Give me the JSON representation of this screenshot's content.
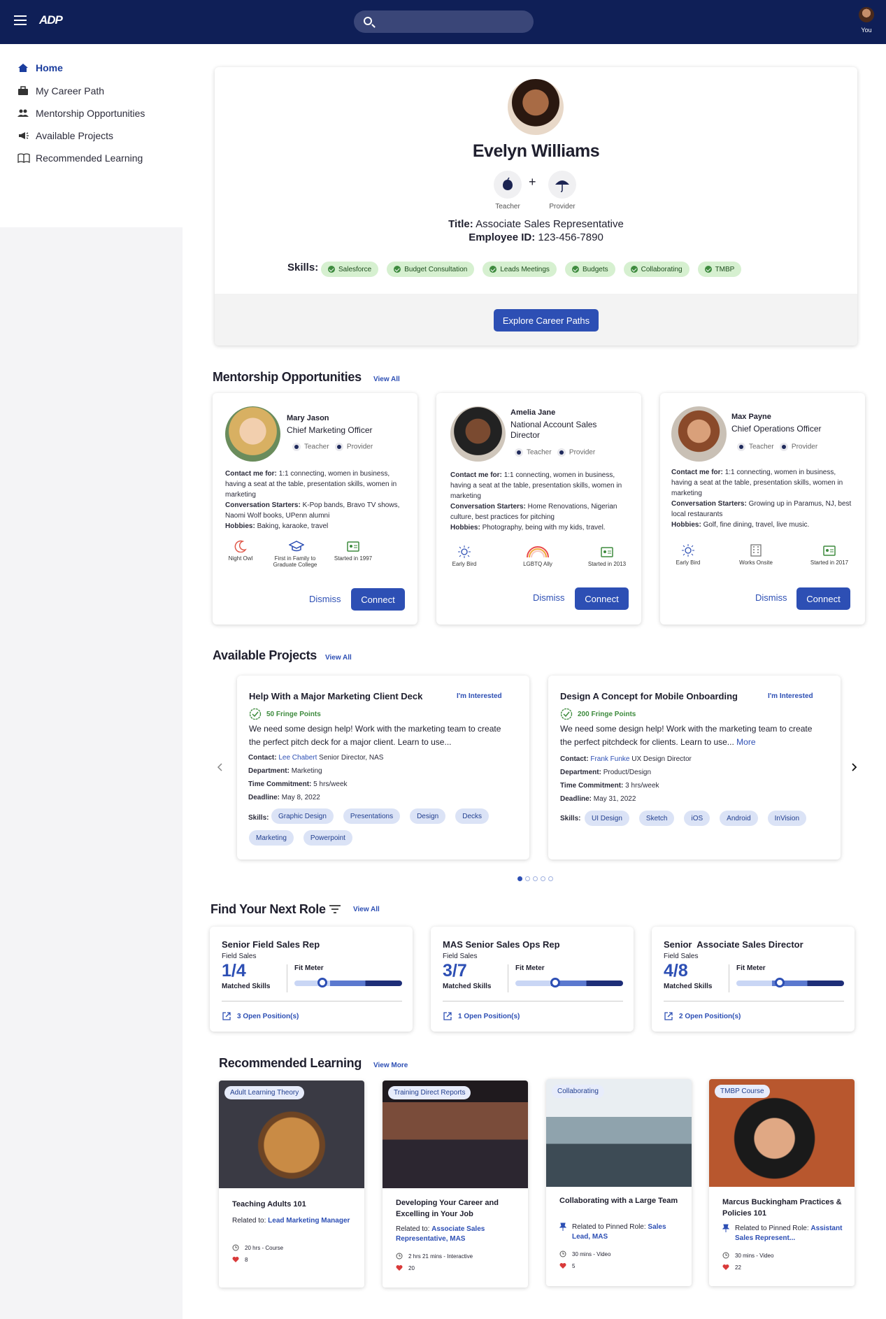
{
  "header": {
    "user_label": "You"
  },
  "sidebar": {
    "items": [
      {
        "label": "Home",
        "icon": "home-icon"
      },
      {
        "label": "My Career Path",
        "icon": "briefcase-icon"
      },
      {
        "label": "Mentorship Opportunities",
        "icon": "people-icon"
      },
      {
        "label": "Available Projects",
        "icon": "megaphone-icon"
      },
      {
        "label": "Recommended Learning",
        "icon": "book-icon"
      }
    ]
  },
  "profile": {
    "name": "Evelyn Williams",
    "roles": [
      "Teacher",
      "Provider"
    ],
    "plus": "+",
    "title_label": "Title:",
    "title": "Associate Sales Representative",
    "employee_label": "Employee ID:",
    "employee_id": "123-456-7890",
    "skills_label": "Skills:",
    "skills": [
      "Salesforce",
      "Budget Consultation",
      "Leads Meetings",
      "Budgets",
      "Collaborating",
      "TMBP"
    ],
    "explore_button": "Explore Career Paths"
  },
  "mentorship": {
    "heading": "Mentorship Opportunities",
    "view_all": "View All",
    "role_teacher": "Teacher",
    "role_provider": "Provider",
    "contact_label": "Contact me for:",
    "starters_label": "Conversation Starters:",
    "hobbies_label": "Hobbies:",
    "dismiss": "Dismiss",
    "connect": "Connect",
    "mentors": [
      {
        "name": "Mary Jason",
        "title": "Chief Marketing Officer",
        "contact": "1:1 connecting, women in business, having a seat at the table, presentation skills, women in marketing",
        "starters": "K-Pop bands, Bravo TV shows, Naomi Wolf books, UPenn alumni",
        "hobbies": "Baking, karaoke, travel",
        "badges": [
          "Night Owl",
          "First in Family to Graduate College",
          "Started in 1997"
        ]
      },
      {
        "name": "Amelia Jane",
        "title": "National Account Sales Director",
        "contact": "1:1 connecting, women in business, having a seat at the table, presentation skills, women in marketing",
        "starters": "Home Renovations, Nigerian culture, best practices for pitching",
        "hobbies": "Photography, being with my kids, travel.",
        "badges": [
          "Early Bird",
          "LGBTQ Ally",
          "Started in 2013"
        ]
      },
      {
        "name": "Max Payne",
        "title": "Chief Operations Officer",
        "contact": "1:1 connecting, women in business, having a seat at the table, presentation skills, women in marketing",
        "starters": "Growing up in Paramus, NJ, best local restaurants",
        "hobbies": "Golf, fine dining, travel, live music.",
        "badges": [
          "Early Bird",
          "Works Onsite",
          "Started in 2017"
        ]
      }
    ]
  },
  "projects": {
    "heading": "Available Projects",
    "view_all": "View All",
    "interested": "I'm Interested",
    "contact_label": "Contact:",
    "department_label": "Department:",
    "time_label": "Time Commitment:",
    "deadline_label": "Deadline:",
    "skills_label": "Skills:",
    "items": [
      {
        "title": "Help With a Major Marketing Client Deck",
        "points": "50 Fringe Points",
        "description": "We need some design help! Work with the marketing team to create the perfect pitch deck for a major client. Learn to use...",
        "more": "",
        "contact_name": "Lee Chabert",
        "contact_role": "Senior Director, NAS",
        "department": "Marketing",
        "time": "5 hrs/week",
        "deadline": "May 8, 2022",
        "skills": [
          "Graphic Design",
          "Presentations",
          "Design",
          "Decks",
          "Marketing",
          "Powerpoint"
        ]
      },
      {
        "title": "Design A Concept for Mobile Onboarding",
        "points": "200 Fringe Points",
        "description": "We need some design help! Work with the marketing team to create the perfect pitchdeck for clients. Learn to use...",
        "more": "More",
        "contact_name": "Frank Funke",
        "contact_role": "UX Design Director",
        "department": "Product/Design",
        "time": "3 hrs/week",
        "deadline": "May 31, 2022",
        "skills": [
          "UI Design",
          "Sketch",
          "iOS",
          "Android",
          "InVision"
        ]
      }
    ],
    "carousel_count": 5,
    "carousel_active": 0
  },
  "roles": {
    "heading": "Find Your Next Role",
    "view_all": "View All",
    "matched_label": "Matched Skills",
    "fit_label": "Fit Meter",
    "items": [
      {
        "title": "Senior Field Sales Rep",
        "dept": "Field Sales",
        "matched": "1/4",
        "fit": 0.26,
        "openings": "3 Open Position(s)"
      },
      {
        "title": "MAS Senior Sales Ops Rep",
        "dept": "Field Sales",
        "matched": "3/7",
        "fit": 0.37,
        "openings": "1 Open Position(s)"
      },
      {
        "title": "Senior  Associate Sales Director",
        "dept": "Field Sales",
        "matched": "4/8",
        "fit": 0.4,
        "openings": "2 Open Position(s)"
      }
    ]
  },
  "learning": {
    "heading": "Recommended Learning",
    "view_more": "View More",
    "items": [
      {
        "tag": "Adult Learning Theory",
        "title": "Teaching Adults 101",
        "related_label": "Related to:",
        "related": "Lead Marketing Manager",
        "meta": "20 hrs - Course",
        "likes": "8"
      },
      {
        "tag": "Training Direct Reports",
        "title": "Developing Your Career and Excelling in Your Job",
        "related_label": "Related to:",
        "related": "Associate Sales Representative, MAS",
        "meta": "2 hrs 21 mins - Interactive",
        "likes": "20"
      },
      {
        "tag": "Collaborating",
        "title": "Collaborating with a Large Team",
        "related_label": "Related to Pinned Role:",
        "related": "Sales Lead, MAS",
        "meta": "30 mins - Video",
        "likes": "5"
      },
      {
        "tag": "TMBP Course",
        "title": "Marcus Buckingham Practices & Policies 101",
        "related_label": "Related to Pinned Role:",
        "related": "Assistant Sales Represent...",
        "meta": "30 mins - Video",
        "likes": "22"
      }
    ]
  },
  "colors": {
    "navy": "#0f1f57",
    "accent": "#2d4fb4",
    "skill_chip": "#d6f0d0",
    "project_chip": "#dbe3f6"
  }
}
